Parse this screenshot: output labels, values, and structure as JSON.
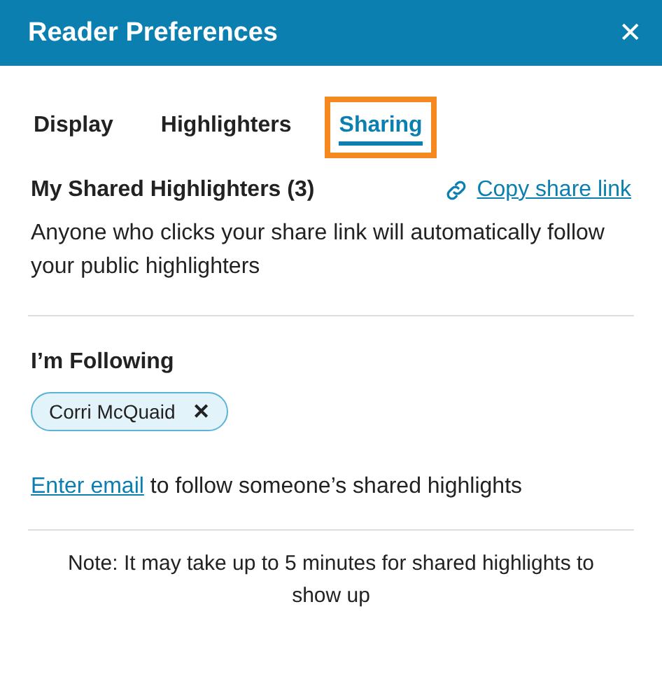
{
  "header": {
    "title": "Reader Preferences",
    "close": "✕"
  },
  "tabs": [
    {
      "label": "Display",
      "selected": false,
      "outlined": false
    },
    {
      "label": "Highlighters",
      "selected": false,
      "outlined": false
    },
    {
      "label": "Sharing",
      "selected": true,
      "outlined": true
    }
  ],
  "shared": {
    "heading": "My Shared Highlighters (3)",
    "link": "Copy share link",
    "description": "Anyone who clicks your share link will automatically follow your public highlighters"
  },
  "following": {
    "heading": "I’m Following",
    "chips": [
      {
        "name": "Corri McQuaid",
        "remove": "✕"
      }
    ],
    "email_link": "Enter email",
    "email_text": " to follow someone’s shared highlights"
  },
  "note": "Note: It may take up to 5 minutes for shared highlights to show up"
}
